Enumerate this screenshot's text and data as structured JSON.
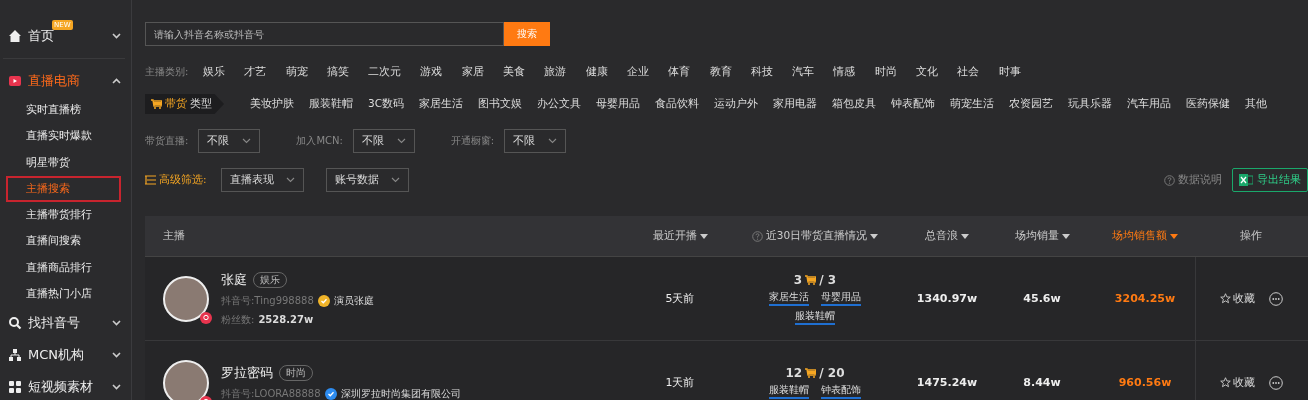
{
  "sidebar": {
    "sections": [
      {
        "label": "首页",
        "badge": "NEW",
        "expanded": false,
        "selected": false
      },
      {
        "label": "直播电商",
        "expanded": true,
        "selected": true,
        "children": [
          {
            "label": "实时直播榜",
            "selected": false
          },
          {
            "label": "直播实时爆款",
            "selected": false
          },
          {
            "label": "明星带货",
            "selected": false
          },
          {
            "label": "主播搜索",
            "selected": true
          },
          {
            "label": "主播带货排行",
            "selected": false
          },
          {
            "label": "直播间搜索",
            "selected": false
          },
          {
            "label": "直播商品排行",
            "selected": false
          },
          {
            "label": "直播热门小店",
            "selected": false
          }
        ]
      },
      {
        "label": "找抖音号",
        "expanded": false,
        "selected": false
      },
      {
        "label": "MCN机构",
        "expanded": false,
        "selected": false
      },
      {
        "label": "短视频素材",
        "expanded": false,
        "selected": false
      }
    ]
  },
  "search": {
    "placeholder": "请输入抖音名称或抖音号",
    "button": "搜索"
  },
  "category_filter": {
    "label": "主播类别:",
    "options": [
      "娱乐",
      "才艺",
      "萌宠",
      "搞笑",
      "二次元",
      "游戏",
      "家居",
      "美食",
      "旅游",
      "健康",
      "企业",
      "体育",
      "教育",
      "科技",
      "汽车",
      "情感",
      "时尚",
      "文化",
      "社会",
      "时事"
    ]
  },
  "goods_filter": {
    "label_accent": "带货",
    "label_rest": "类型",
    "options": [
      "美妆护肤",
      "服装鞋帽",
      "3C数码",
      "家居生活",
      "图书文娱",
      "办公文具",
      "母婴用品",
      "食品饮料",
      "运动户外",
      "家用电器",
      "箱包皮具",
      "钟表配饰",
      "萌宠生活",
      "农资园艺",
      "玩具乐器",
      "汽车用品",
      "医药保健",
      "其他"
    ]
  },
  "dropdown_filters": [
    {
      "label": "带货直播:",
      "value": "不限"
    },
    {
      "label": "加入MCN:",
      "value": "不限"
    },
    {
      "label": "开通橱窗:",
      "value": "不限"
    }
  ],
  "advanced_filter": {
    "label": "高级筛选:",
    "dropdowns": [
      "直播表现",
      "账号数据"
    ],
    "help": "数据说明",
    "export": "导出结果"
  },
  "table": {
    "columns": [
      {
        "label": "主播",
        "sortable": false,
        "help": false,
        "selected": false
      },
      {
        "label": "最近开播",
        "sortable": true,
        "help": false,
        "selected": false
      },
      {
        "label": "近30日带货直播情况",
        "sortable": true,
        "help": true,
        "selected": false
      },
      {
        "label": "总音浪",
        "sortable": true,
        "help": false,
        "selected": false
      },
      {
        "label": "场均销量",
        "sortable": true,
        "help": false,
        "selected": false
      },
      {
        "label": "场均销售额",
        "sortable": true,
        "help": false,
        "selected": true
      },
      {
        "label": "操作",
        "sortable": false,
        "help": false,
        "selected": false
      }
    ],
    "rows": [
      {
        "name": "张庭",
        "tag": "娱乐",
        "douyin_id": "抖音号:Ting998888",
        "verify": {
          "color": "#f0b429",
          "text": "演员张庭"
        },
        "fans_label": "粉丝数:",
        "fans": "2528.27w",
        "live_count": "3",
        "live_total": "/ 3",
        "live_categories": [
          "家居生活",
          "母婴用品",
          "服装鞋帽"
        ],
        "recent": "5天前",
        "gifts": "1340.97w",
        "avg_sales": "45.6w",
        "avg_revenue": "3204.25w",
        "favorite": "收藏"
      },
      {
        "name": "罗拉密码",
        "tag": "时尚",
        "douyin_id": "抖音号:LOORA88888",
        "verify": {
          "color": "#2d8cf0",
          "text": "深圳罗拉时尚集团有限公司"
        },
        "live_count": "12",
        "live_total": "/ 20",
        "live_categories": [
          "服装鞋帽",
          "钟表配饰"
        ],
        "recent": "1天前",
        "gifts": "1475.24w",
        "avg_sales": "8.44w",
        "avg_revenue": "960.56w",
        "favorite": "收藏"
      }
    ]
  }
}
